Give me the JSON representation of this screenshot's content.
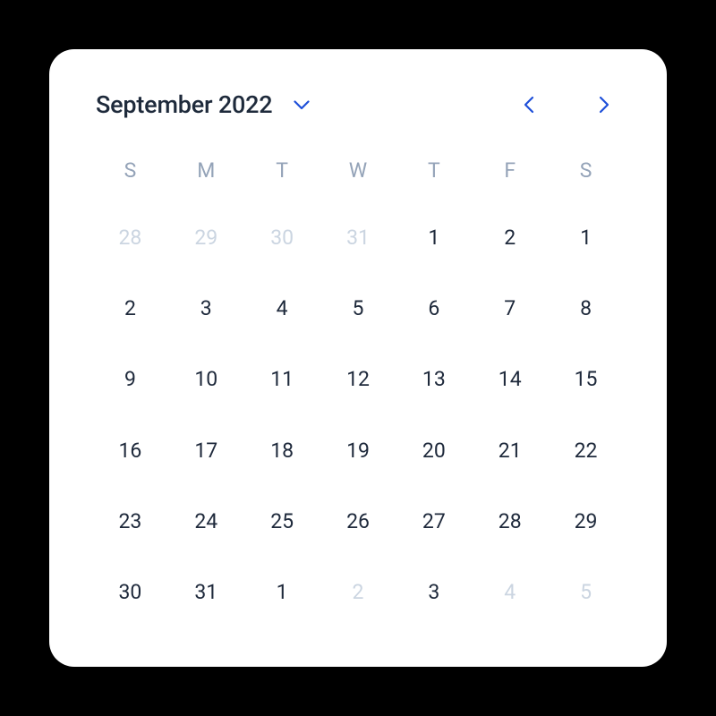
{
  "header": {
    "month_year": "September 2022"
  },
  "colors": {
    "accent": "#1e4fd9",
    "text": "#1e293b",
    "muted": "#cbd5e1",
    "weekday": "#94a3b8"
  },
  "weekdays": [
    "S",
    "M",
    "T",
    "W",
    "T",
    "F",
    "S"
  ],
  "days": [
    {
      "label": "28",
      "muted": true
    },
    {
      "label": "29",
      "muted": true
    },
    {
      "label": "30",
      "muted": true
    },
    {
      "label": "31",
      "muted": true
    },
    {
      "label": "1",
      "muted": false
    },
    {
      "label": "2",
      "muted": false
    },
    {
      "label": "1",
      "muted": false
    },
    {
      "label": "2",
      "muted": false
    },
    {
      "label": "3",
      "muted": false
    },
    {
      "label": "4",
      "muted": false
    },
    {
      "label": "5",
      "muted": false
    },
    {
      "label": "6",
      "muted": false
    },
    {
      "label": "7",
      "muted": false
    },
    {
      "label": "8",
      "muted": false
    },
    {
      "label": "9",
      "muted": false
    },
    {
      "label": "10",
      "muted": false
    },
    {
      "label": "11",
      "muted": false
    },
    {
      "label": "12",
      "muted": false
    },
    {
      "label": "13",
      "muted": false
    },
    {
      "label": "14",
      "muted": false
    },
    {
      "label": "15",
      "muted": false
    },
    {
      "label": "16",
      "muted": false
    },
    {
      "label": "17",
      "muted": false
    },
    {
      "label": "18",
      "muted": false
    },
    {
      "label": "19",
      "muted": false
    },
    {
      "label": "20",
      "muted": false
    },
    {
      "label": "21",
      "muted": false
    },
    {
      "label": "22",
      "muted": false
    },
    {
      "label": "23",
      "muted": false
    },
    {
      "label": "24",
      "muted": false
    },
    {
      "label": "25",
      "muted": false
    },
    {
      "label": "26",
      "muted": false
    },
    {
      "label": "27",
      "muted": false
    },
    {
      "label": "28",
      "muted": false
    },
    {
      "label": "29",
      "muted": false
    },
    {
      "label": "30",
      "muted": false
    },
    {
      "label": "31",
      "muted": false
    },
    {
      "label": "1",
      "muted": false
    },
    {
      "label": "2",
      "muted": true
    },
    {
      "label": "3",
      "muted": false
    },
    {
      "label": "4",
      "muted": true
    },
    {
      "label": "5",
      "muted": true
    }
  ]
}
